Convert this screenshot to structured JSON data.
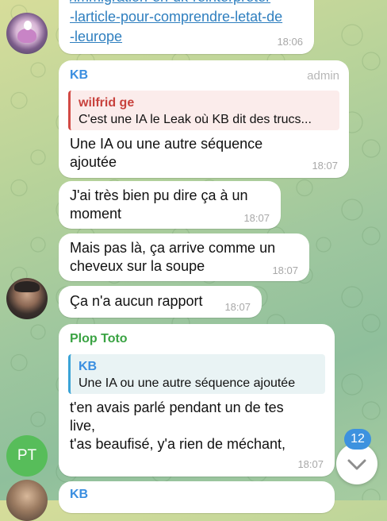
{
  "messages": {
    "m1": {
      "link_lines": [
        "/immigration-en-uk-reinterpreter",
        "-larticle-pour-comprendre-letat-de",
        "-leurope"
      ],
      "time": "18:06"
    },
    "m2": {
      "sender": "KB",
      "role": "admin",
      "reply": {
        "name": "wilfrid ge",
        "text": "C'est une IA le Leak où KB dit des trucs..."
      },
      "text_lines": [
        "Une IA ou une autre séquence",
        "ajoutée"
      ],
      "time": "18:07"
    },
    "m3": {
      "text_lines": [
        "J'ai très bien pu dire ça à un",
        "moment"
      ],
      "time": "18:07"
    },
    "m4": {
      "text_lines": [
        "Mais pas là, ça arrive comme un",
        "cheveux sur la soupe"
      ],
      "time": "18:07"
    },
    "m5": {
      "text": "Ça n'a aucun rapport",
      "time": "18:07"
    },
    "m6": {
      "sender": "Plop Toto",
      "reply": {
        "name": "KB",
        "text": "Une IA ou une autre séquence ajoutée"
      },
      "text_lines": [
        "t'en avais parlé pendant un de tes",
        "live,",
        "t'as beaufisé, y'a rien de méchant,"
      ],
      "time": "18:07"
    },
    "m7": {
      "sender": "KB"
    }
  },
  "avatars": {
    "pt_initials": "PT"
  },
  "scroll": {
    "unread_count": "12",
    "icon": "chevron-down-icon"
  },
  "colors": {
    "kb_name": "#3a8ee0",
    "wilfrid": "#c8423d",
    "plop": "#3aa343",
    "reply_kb_bar": "#3aa3d6",
    "reply_wilfrid_bar": "#d24a45"
  }
}
